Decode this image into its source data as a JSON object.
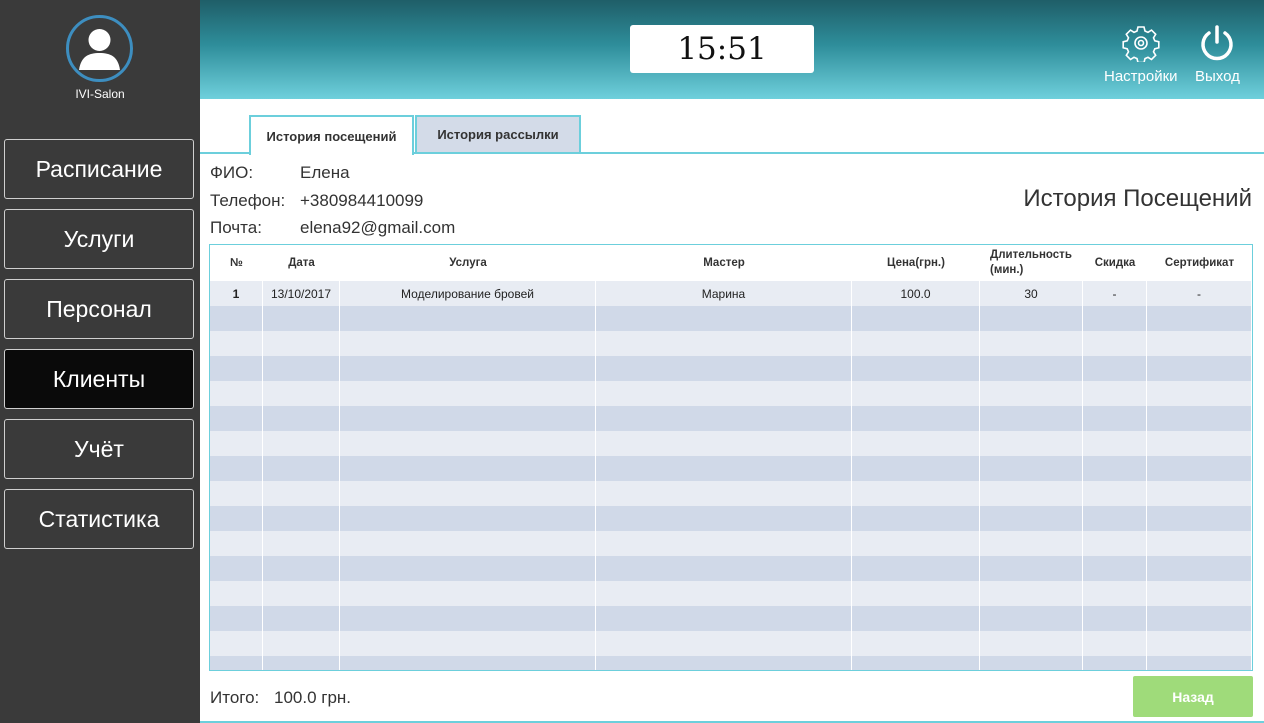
{
  "app": {
    "name": "IVI-Salon"
  },
  "sidebar": {
    "items": [
      {
        "label": "Расписание",
        "active": false
      },
      {
        "label": "Услуги",
        "active": false
      },
      {
        "label": "Персонал",
        "active": false
      },
      {
        "label": "Клиенты",
        "active": true
      },
      {
        "label": "Учёт",
        "active": false
      },
      {
        "label": "Статистика",
        "active": false
      }
    ]
  },
  "header": {
    "time": "15:51",
    "settings_label": "Настройки",
    "exit_label": "Выход"
  },
  "tabs": [
    {
      "label": "История посещений",
      "active": true
    },
    {
      "label": "История рассылки",
      "active": false
    }
  ],
  "client": {
    "name_label": "ФИО:",
    "name": "Елена",
    "phone_label": "Телефон:",
    "phone": "+380984410099",
    "email_label": "Почта:",
    "email": "elena92@gmail.com"
  },
  "section_title": "История Посещений",
  "table": {
    "columns": [
      "№",
      "Дата",
      "Услуга",
      "Мастер",
      "Цена(грн.)",
      "Длительность (мин.)",
      "Скидка",
      "Сертификат"
    ],
    "rows": [
      [
        "1",
        "13/10/2017",
        "Моделирование бровей",
        "Марина",
        "100.0",
        "30",
        "-",
        "-"
      ]
    ],
    "empty_rows": 15
  },
  "footer": {
    "total_label": "Итого:",
    "total_value": "100.0 грн.",
    "back_label": "Назад"
  },
  "colors": {
    "sidebar_bg": "#3a3a3a",
    "accent": "#6ccfdc",
    "row_light": "#e8ecf3",
    "row_dark": "#d0d9e8",
    "back_button": "#9fdb7a"
  }
}
